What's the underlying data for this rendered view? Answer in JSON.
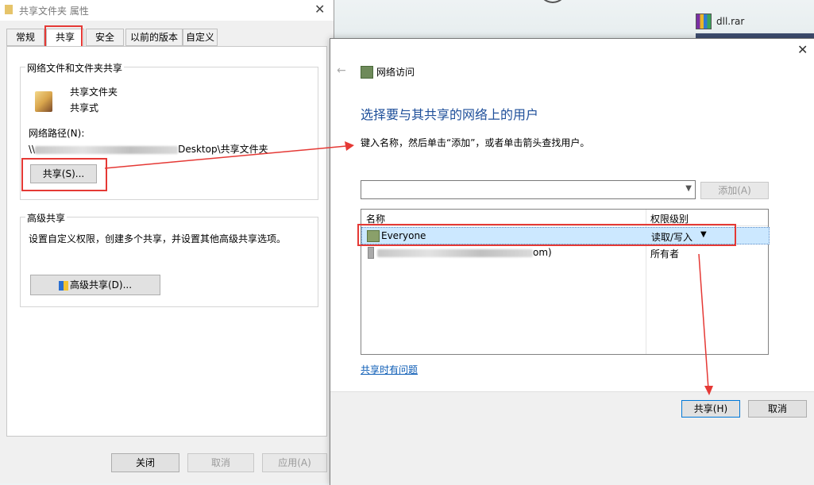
{
  "desktop": {
    "file_name": "dll.rar"
  },
  "properties_dialog": {
    "title": "共享文件夹 属性",
    "tabs": [
      "常规",
      "共享",
      "安全",
      "以前的版本",
      "自定义"
    ],
    "active_tab": "共享",
    "network_group": {
      "label": "网络文件和文件夹共享",
      "folder_name": "共享文件夹",
      "status": "共享式",
      "path_label": "网络路径(N):",
      "path_prefix": "\\\\",
      "path_suffix": "Desktop\\共享文件夹",
      "share_button": "共享(S)..."
    },
    "advanced_group": {
      "label": "高级共享",
      "description": "设置自定义权限，创建多个共享，并设置其他高级共享选项。",
      "button": "高级共享(D)..."
    },
    "footer": {
      "close": "关闭",
      "cancel": "取消",
      "apply": "应用(A)"
    }
  },
  "network_access_dialog": {
    "title": "网络访问",
    "heading": "选择要与其共享的网络上的用户",
    "instruction": "键入名称，然后单击“添加”，或者单击箭头查找用户。",
    "input_value": "",
    "add_button": "添加(A)",
    "columns": {
      "name": "名称",
      "permission": "权限级别"
    },
    "rows": [
      {
        "name": "Everyone",
        "permission": "读取/写入",
        "selected": true
      },
      {
        "name_suffix": "om)",
        "permission": "所有者",
        "selected": false
      }
    ],
    "help_link": "共享时有问题",
    "share_button": "共享(H)",
    "cancel_button": "取消"
  },
  "colors": {
    "highlight_red": "#e53935",
    "heading_blue": "#1e4f9a",
    "link_blue": "#0a5bb5",
    "selection_blue": "#cce8ff"
  }
}
